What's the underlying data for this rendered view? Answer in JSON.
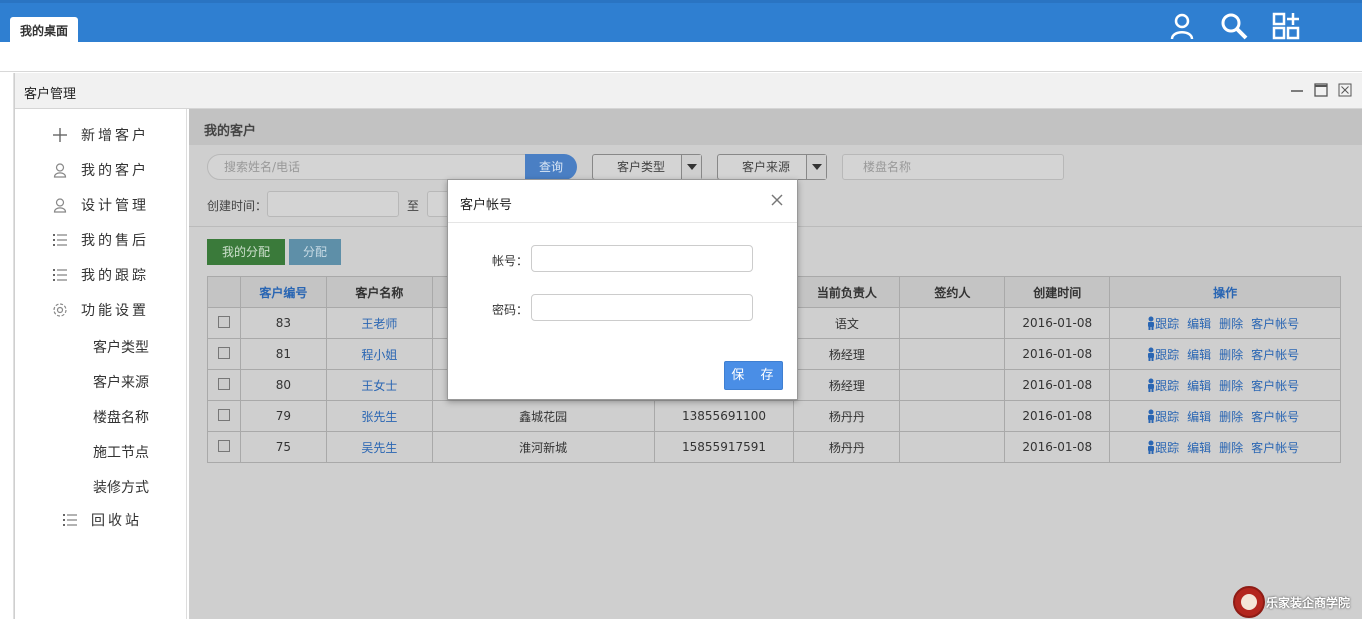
{
  "topbar": {
    "tab": "我的桌面",
    "icons": [
      "user-icon",
      "search-icon",
      "apps-icon"
    ]
  },
  "window": {
    "title": "客户管理"
  },
  "sidebar": {
    "items": [
      {
        "label": "新增客户",
        "icon": "plus-icon"
      },
      {
        "label": "我的客户",
        "icon": "user-icon"
      },
      {
        "label": "设计管理",
        "icon": "user-icon"
      },
      {
        "label": "我的售后",
        "icon": "list-icon"
      },
      {
        "label": "我的跟踪",
        "icon": "list-icon"
      },
      {
        "label": "功能设置",
        "icon": "gear-icon"
      }
    ],
    "sub_items": [
      "客户类型",
      "客户来源",
      "楼盘名称",
      "施工节点",
      "装修方式"
    ],
    "recycle": {
      "label": "回收站",
      "icon": "list-icon"
    }
  },
  "main": {
    "section_title": "我的客户",
    "search_placeholder": "搜索姓名/电话",
    "search_button": "查询",
    "customer_type": "客户类型",
    "customer_source": "客户来源",
    "building_placeholder": "楼盘名称",
    "created_time_label": "创建时间：",
    "to_label": "至",
    "btn_my_assign": "我的分配",
    "btn_assign": "分配"
  },
  "table": {
    "headers": [
      "客户编号",
      "客户名称",
      "",
      "",
      "当前负责人",
      "签约人",
      "创建时间",
      "操作"
    ],
    "rows": [
      {
        "id": "83",
        "name": "王老师",
        "building": "",
        "phone": "",
        "owner": "语文",
        "signer": "",
        "created": "2016-01-08"
      },
      {
        "id": "81",
        "name": "程小姐",
        "building": "",
        "phone": "",
        "owner": "杨经理",
        "signer": "",
        "created": "2016-01-08"
      },
      {
        "id": "80",
        "name": "王女士",
        "building": "",
        "phone": "",
        "owner": "杨经理",
        "signer": "",
        "created": "2016-01-08"
      },
      {
        "id": "79",
        "name": "张先生",
        "building": "鑫城花园",
        "phone": "13855691100",
        "owner": "杨丹丹",
        "signer": "",
        "created": "2016-01-08"
      },
      {
        "id": "75",
        "name": "吴先生",
        "building": "淮河新城",
        "phone": "15855917591",
        "owner": "杨丹丹",
        "signer": "",
        "created": "2016-01-08"
      }
    ],
    "ops": [
      "跟踪",
      "编辑",
      "删除",
      "客户帐号"
    ]
  },
  "modal": {
    "title": "客户帐号",
    "account_label": "帐号：",
    "password_label": "密码：",
    "save": "保 存"
  },
  "watermark": "乐家装企商学院"
}
